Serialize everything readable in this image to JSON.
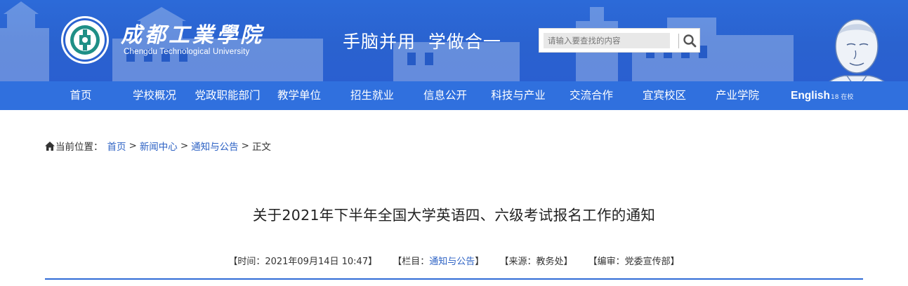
{
  "header": {
    "school_name_cn": "成都工業學院",
    "school_name_en": "Chengdu Technological University",
    "slogan": "手脑并用  学做合一",
    "search": {
      "placeholder": "请输入要查找的内容",
      "icon": "search-icon"
    },
    "portrait_tag": "18 在校"
  },
  "nav": {
    "items": [
      "首页",
      "学校概况",
      "党政职能部门",
      "教学单位",
      "招生就业",
      "信息公开",
      "科技与产业",
      "交流合作",
      "宜宾校区",
      "产业学院"
    ],
    "english": "English"
  },
  "breadcrumb": {
    "prefix": "当前位置：",
    "items": [
      "首页",
      "新闻中心",
      "通知与公告"
    ],
    "current": "正文",
    "separator": ">"
  },
  "article": {
    "title": "关于2021年下半年全国大学英语四、六级考试报名工作的通知",
    "meta": {
      "time_label": "【时间：",
      "time": "2021年09月14日 10:47",
      "time_end": "】",
      "column_label": "【栏目：",
      "column": "通知与公告",
      "column_end": "】",
      "source_label": "【来源：",
      "source": "教务处",
      "source_end": "】",
      "editor_label": "【编审：",
      "editor": "党委宣传部",
      "editor_end": "】"
    }
  },
  "colors": {
    "banner": "#2a62cf",
    "nav": "#3070de",
    "link": "#2d62c4",
    "rule": "#2f6bd6"
  }
}
